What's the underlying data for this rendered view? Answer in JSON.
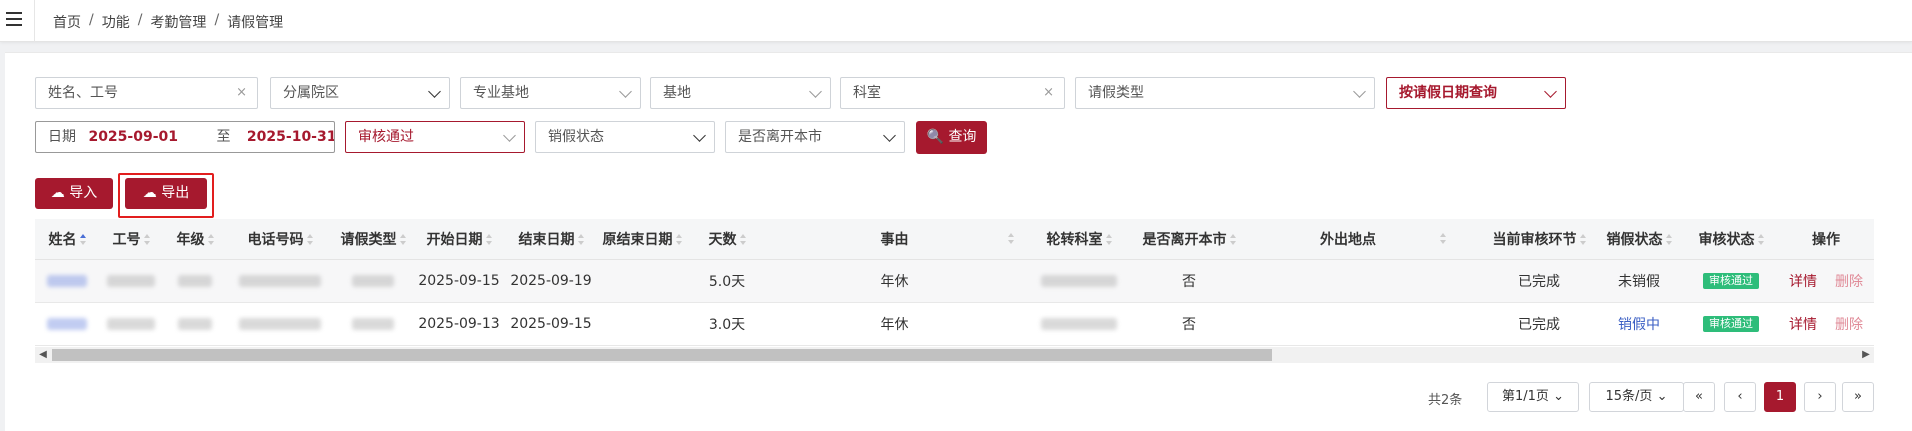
{
  "breadcrumb": [
    "首页",
    "功能",
    "考勤管理",
    "请假管理"
  ],
  "filters": {
    "name_placeholder": "姓名、工号",
    "campus": "分属院区",
    "pro_base": "专业基地",
    "base": "基地",
    "dept": "科室",
    "leave_type": "请假类型",
    "date_mode": "按请假日期查询",
    "date_label": "日期",
    "date_from": "2025-09-01",
    "date_to_label": "至",
    "date_to": "2025-10-31",
    "review_status": "审核通过",
    "cancel_status": "销假状态",
    "leave_city": "是否离开本市",
    "clear_icon": "×"
  },
  "buttons": {
    "query": "查询",
    "import": "导入",
    "export": "导出"
  },
  "table": {
    "columns": [
      "姓名",
      "工号",
      "年级",
      "电话号码",
      "请假类型",
      "开始日期",
      "结束日期",
      "原结束日期",
      "天数",
      "事由",
      "轮转科室",
      "是否离开本市",
      "外出地点",
      "",
      "当前审核环节",
      "销假状态",
      "审核状态",
      "操作"
    ],
    "rows": [
      {
        "start": "2025-09-15",
        "end": "2025-09-19",
        "orig_end": "",
        "days": "5.0天",
        "reason": "年休",
        "leave_city": "否",
        "place": "",
        "review_step": "已完成",
        "cancel_status": "未销假",
        "audit_status": "审核通过",
        "detail": "详情",
        "delete": "删除"
      },
      {
        "start": "2025-09-13",
        "end": "2025-09-15",
        "orig_end": "",
        "days": "3.0天",
        "reason": "年休",
        "leave_city": "否",
        "place": "",
        "review_step": "已完成",
        "cancel_status": "销假中",
        "audit_status": "审核通过",
        "detail": "详情",
        "delete": "删除"
      }
    ]
  },
  "pagination": {
    "total": "共2条",
    "page_info": "第1/1页",
    "page_size": "15条/页",
    "first": "«",
    "prev": "‹",
    "current": "1",
    "next": "›",
    "last": "»"
  },
  "colors": {
    "brand": "#a6192e",
    "badge": "#2ebd7a",
    "link_blue": "#3b5fc4"
  }
}
